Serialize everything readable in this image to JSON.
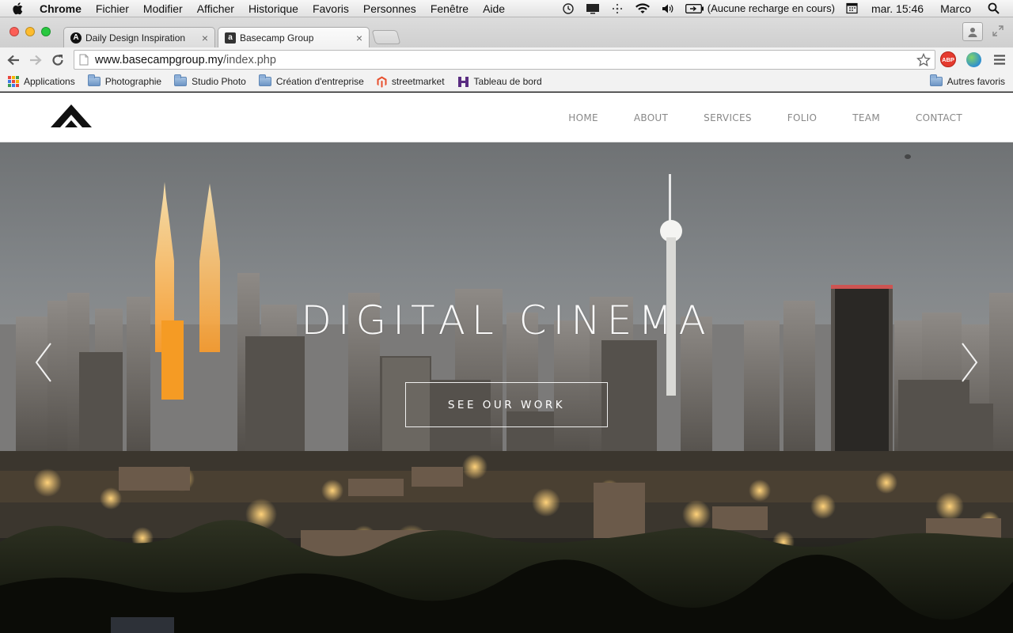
{
  "menubar": {
    "app": "Chrome",
    "items": [
      "Fichier",
      "Modifier",
      "Afficher",
      "Historique",
      "Favoris",
      "Personnes",
      "Fenêtre",
      "Aide"
    ],
    "battery_status": "(Aucune recharge en cours)",
    "clock": "mar. 15:46",
    "user": "Marco"
  },
  "tabs": [
    {
      "title": "Daily Design Inspiration",
      "favicon": "A",
      "active": false
    },
    {
      "title": "Basecamp Group",
      "favicon": "a",
      "active": true
    }
  ],
  "toolbar": {
    "url_host": "www.basecampgroup.my",
    "url_path": "/index.php",
    "extensions": [
      "adblock-plus-icon",
      "globe-extension-icon"
    ],
    "abp_label": "ABP"
  },
  "bookmarks": {
    "items": [
      "Applications",
      "Photographie",
      "Studio Photo",
      "Création d'entreprise",
      "streetmarket",
      "Tableau de bord"
    ],
    "other": "Autres favoris"
  },
  "site": {
    "nav": [
      "HOME",
      "ABOUT",
      "SERVICES",
      "FOLIO",
      "TEAM",
      "CONTACT"
    ],
    "hero": {
      "title": "DIGITAL CINEMA",
      "cta": "SEE OUR WORK"
    }
  },
  "colors": {
    "nav_text": "#888888",
    "header_bg": "#ffffff",
    "hero_text": "#ffffff"
  }
}
